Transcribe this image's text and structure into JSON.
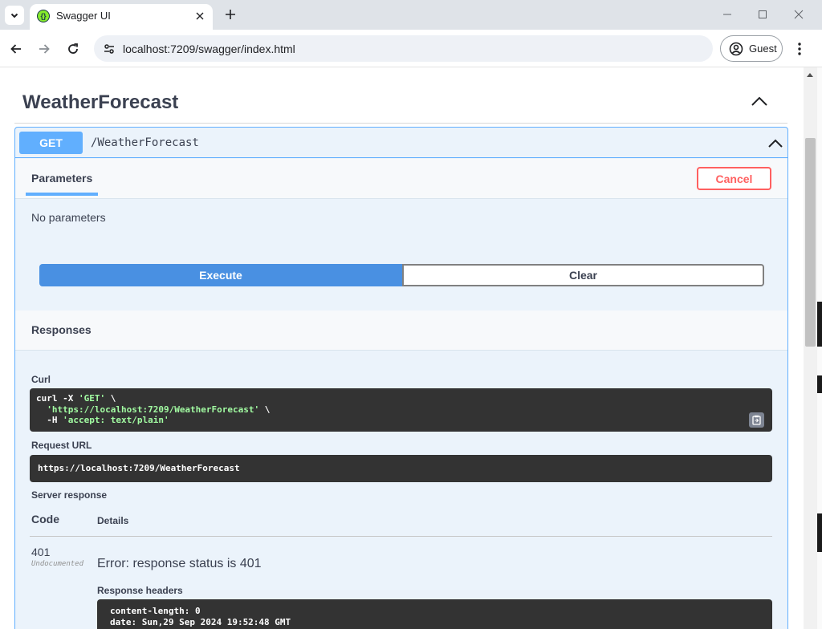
{
  "browser": {
    "tab_title": "Swagger UI",
    "url": "localhost:7209/swagger/index.html",
    "profile_label": "Guest"
  },
  "section": {
    "title": "WeatherForecast"
  },
  "operation": {
    "method": "GET",
    "path": "/WeatherForecast",
    "parameters_tab": "Parameters",
    "cancel_label": "Cancel",
    "no_params": "No parameters",
    "execute_label": "Execute",
    "clear_label": "Clear"
  },
  "responses": {
    "title": "Responses",
    "curl_label": "Curl",
    "curl": {
      "line1_cmd": "curl -X ",
      "line1_str": "'GET'",
      "line1_tail": " \\",
      "line2_str": "'https://localhost:7209/WeatherForecast'",
      "line2_tail": " \\",
      "line3_cmd": "-H ",
      "line3_str": "'accept: text/plain'"
    },
    "request_url_label": "Request URL",
    "request_url": "https://localhost:7209/WeatherForecast",
    "server_response_label": "Server response",
    "col_code": "Code",
    "col_details": "Details",
    "status_code": "401",
    "undocumented": "Undocumented",
    "error_text": "Error: response status is 401",
    "headers_label": "Response headers",
    "headers": {
      "line1": "content-length: 0",
      "line2": "date: Sun,29 Sep 2024 19:52:48 GMT"
    }
  },
  "icons": {
    "tab_menu": "chevron-down-icon",
    "favicon": "swagger-logo-icon",
    "close": "close-icon",
    "new_tab": "plus-icon",
    "back": "arrow-left-icon",
    "forward": "arrow-right-icon",
    "reload": "reload-icon",
    "site_info": "tune-icon",
    "profile": "account-circle-icon",
    "menu": "more-vert-icon",
    "collapse": "chevron-up-icon",
    "copy": "clipboard-icon"
  },
  "colors": {
    "get_method": "#61affe",
    "execute": "#4990e2",
    "cancel": "#ff6060",
    "code_bg": "#333333",
    "code_string": "#a2fca2"
  }
}
